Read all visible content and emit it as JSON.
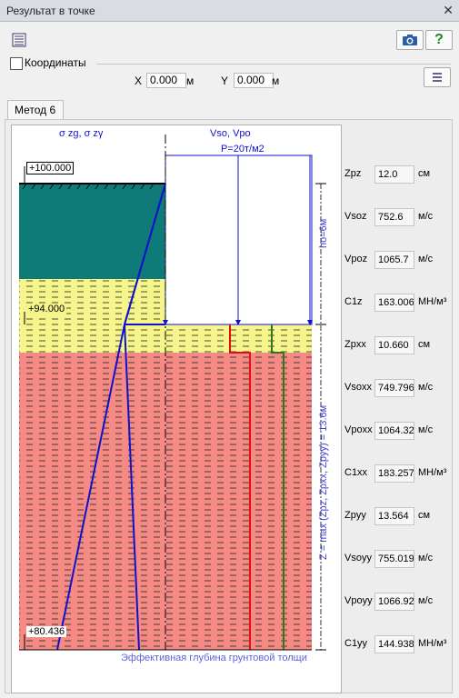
{
  "window": {
    "title": "Результат в точке",
    "close_icon": "close-icon"
  },
  "toolbar": {
    "list_icon": "list-icon",
    "camera_icon": "camera-icon",
    "help_icon": "help-icon"
  },
  "coords": {
    "checkbox_label": "Координаты",
    "x_label": "X",
    "x_value": "0.000",
    "x_unit": "м",
    "y_label": "Y",
    "y_value": "0.000",
    "y_unit": "м",
    "apply_icon": "list-icon"
  },
  "tabs": {
    "method": "Метод 6"
  },
  "diagram": {
    "header_left": "σ zg,  σ zγ",
    "header_right": "Vso, Vpo",
    "load_label": "P=20т/м2",
    "top_level": "+100.000",
    "mid_level": "+94.000",
    "bottom_level": "+80.436",
    "h0_label": "ho=6м",
    "z_label": "Z = max (Zpz, Zpxx, Zpyy) = 13.6м",
    "footer": "Эффективная глубина грунтовой толщи",
    "colors": {
      "teal": "#0f7b78",
      "yellow": "#f6f58c",
      "pink": "#f58a84",
      "blue": "#1111cc",
      "red": "#e01010",
      "green": "#2a7a1a"
    }
  },
  "results": [
    {
      "label": "Zpz",
      "value": "12.0",
      "unit": "см"
    },
    {
      "label": "Vsoz",
      "value": "752.6",
      "unit": "м/с"
    },
    {
      "label": "Vpoz",
      "value": "1065.7",
      "unit": "м/с"
    },
    {
      "label": "C1z",
      "value": "163.006",
      "unit": "МН/м³"
    },
    {
      "label": "Zpxx",
      "value": "10.660",
      "unit": "см"
    },
    {
      "label": "Vsoxx",
      "value": "749.796",
      "unit": "м/с"
    },
    {
      "label": "Vpoxx",
      "value": "1064.32",
      "unit": "м/с"
    },
    {
      "label": "C1xx",
      "value": "183.257",
      "unit": "МН/м³"
    },
    {
      "label": "Zpyy",
      "value": "13.564",
      "unit": "см"
    },
    {
      "label": "Vsoyy",
      "value": "755.019",
      "unit": "м/с"
    },
    {
      "label": "Vpoyy",
      "value": "1066.92",
      "unit": "м/с"
    },
    {
      "label": "C1yy",
      "value": "144.938",
      "unit": "МН/м³"
    }
  ]
}
